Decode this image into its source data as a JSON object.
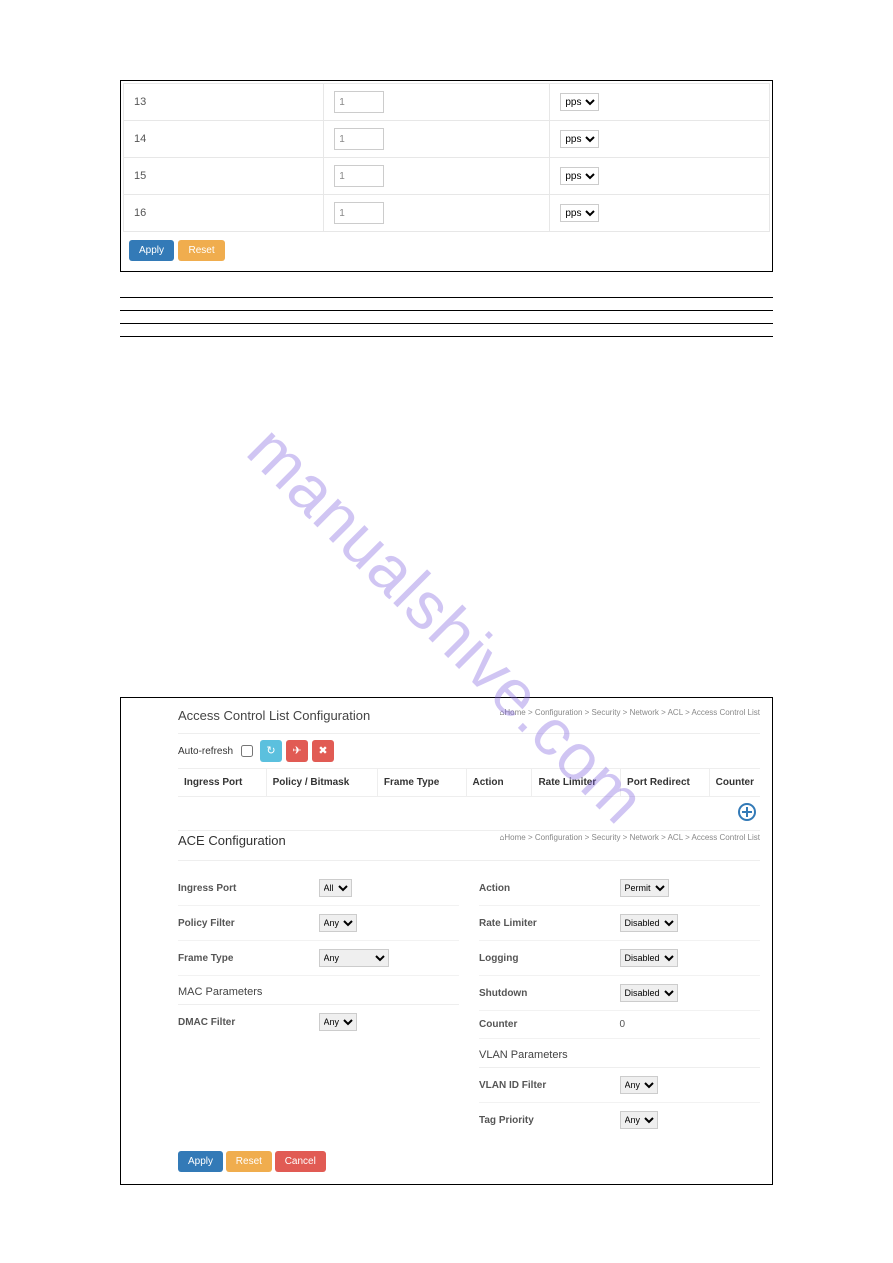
{
  "watermark": "manualshive.com",
  "rate_table": {
    "rows": [
      {
        "id": "13",
        "value": "1",
        "unit": "pps"
      },
      {
        "id": "14",
        "value": "1",
        "unit": "pps"
      },
      {
        "id": "15",
        "value": "1",
        "unit": "pps"
      },
      {
        "id": "16",
        "value": "1",
        "unit": "pps"
      }
    ],
    "apply_label": "Apply",
    "reset_label": "Reset"
  },
  "obj_table": {
    "rows": [
      {
        "c1": "",
        "c2": ""
      },
      {
        "c1": "",
        "c2": ""
      },
      {
        "c1": "",
        "c2": ""
      }
    ]
  },
  "acl": {
    "title": "Access Control List Configuration",
    "breadcrumb_home": "Home",
    "breadcrumb_path": "Configuration > Security > Network > ACL > Access Control List",
    "auto_refresh_label": "Auto-refresh",
    "headers": {
      "ingress": "Ingress Port",
      "policy": "Policy / Bitmask",
      "frame": "Frame Type",
      "action": "Action",
      "rate": "Rate Limiter",
      "redirect": "Port Redirect",
      "counter": "Counter"
    }
  },
  "ace": {
    "title": "ACE Configuration",
    "breadcrumb_home": "Home",
    "breadcrumb_path": "Configuration > Security > Network > ACL > Access Control List",
    "left": {
      "ingress_port": {
        "label": "Ingress Port",
        "value": "All"
      },
      "policy_filter": {
        "label": "Policy Filter",
        "value": "Any"
      },
      "frame_type": {
        "label": "Frame Type",
        "value": "Any"
      },
      "mac_params_head": "MAC Parameters",
      "dmac_filter": {
        "label": "DMAC Filter",
        "value": "Any"
      }
    },
    "right": {
      "action": {
        "label": "Action",
        "value": "Permit"
      },
      "rate_limiter": {
        "label": "Rate Limiter",
        "value": "Disabled"
      },
      "logging": {
        "label": "Logging",
        "value": "Disabled"
      },
      "shutdown": {
        "label": "Shutdown",
        "value": "Disabled"
      },
      "counter": {
        "label": "Counter",
        "value": "0"
      },
      "vlan_params_head": "VLAN Parameters",
      "vlan_id_filter": {
        "label": "VLAN ID Filter",
        "value": "Any"
      },
      "tag_priority": {
        "label": "Tag Priority",
        "value": "Any"
      }
    },
    "buttons": {
      "apply": "Apply",
      "reset": "Reset",
      "cancel": "Cancel"
    }
  }
}
